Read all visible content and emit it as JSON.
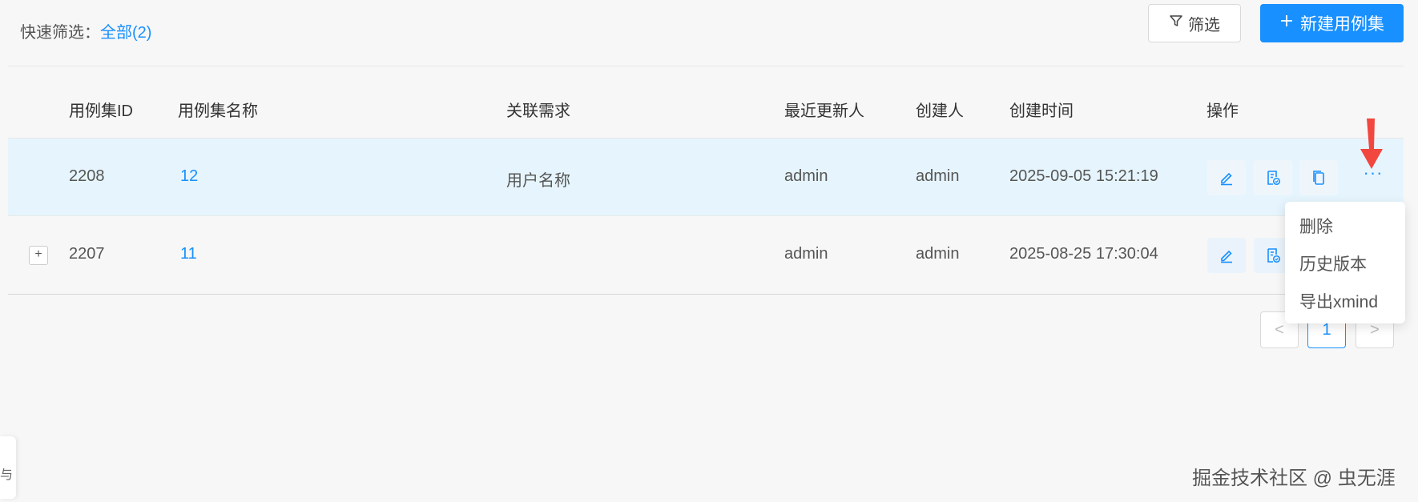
{
  "toolbar": {
    "quick_filter_label": "快速筛选：",
    "quick_filter_value": "全部(2)",
    "filter_button": "筛选",
    "new_button": "新建用例集"
  },
  "table": {
    "columns": [
      "用例集ID",
      "用例集名称",
      "关联需求",
      "最近更新人",
      "创建人",
      "创建时间",
      "操作"
    ],
    "rows": [
      {
        "id": "2208",
        "name": "12",
        "requirement": "用户名称",
        "updater": "admin",
        "creator": "admin",
        "created": "2025-09-05 15:21:19"
      },
      {
        "id": "2207",
        "name": "11",
        "requirement": "",
        "updater": "admin",
        "creator": "admin",
        "created": "2025-08-25 17:30:04"
      }
    ],
    "expand_symbol": "+",
    "more_symbol": "···"
  },
  "dropdown": {
    "items": [
      "删除",
      "历史版本",
      "导出xmind"
    ]
  },
  "pagination": {
    "prev": "<",
    "current": "1",
    "next": ">"
  },
  "side_tab": {
    "label": "与"
  },
  "watermark": "掘金技术社区 @ 虫无涯",
  "colors": {
    "accent": "#1890ff",
    "active_row": "#e6f5fd",
    "arrow": "#f2473f"
  }
}
